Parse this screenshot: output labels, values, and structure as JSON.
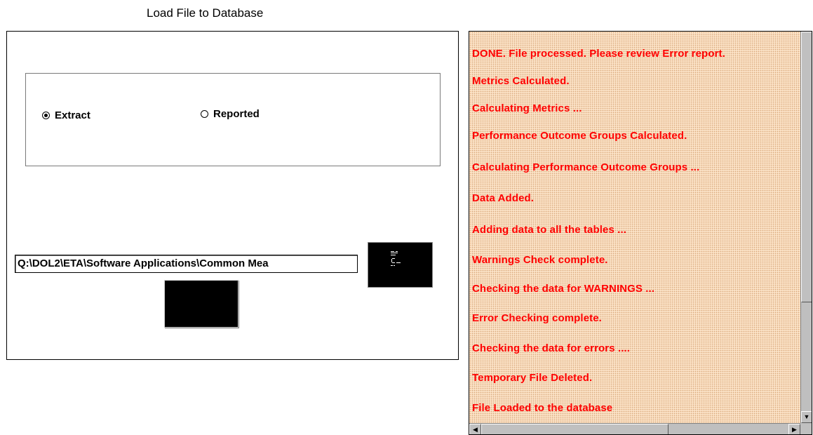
{
  "window": {
    "title": "Load File to Database"
  },
  "file_type": {
    "options": [
      {
        "label": "Extract",
        "selected": true
      },
      {
        "label": "Reported",
        "selected": false
      }
    ]
  },
  "file_path": {
    "value": "Q:\\DOL2\\ETA\\Software Applications\\Common Mea"
  },
  "log": {
    "text_color": "#ff0000",
    "background_color": "#fbe2c6",
    "items": [
      "DONE. File processed. Please review Error report.",
      "Metrics Calculated.",
      "Calculating Metrics ...",
      "Performance Outcome Groups Calculated.",
      "Calculating Performance Outcome Groups ...",
      "Data Added.",
      "Adding data to all the tables ...",
      "Warnings Check complete.",
      "Checking the data for WARNINGS ...",
      "Error Checking complete.",
      "Checking the data for errors ....",
      "Temporary File Deleted.",
      "File Loaded to the database"
    ]
  },
  "icons": {
    "browse": "folder-browse-icon",
    "scroll_down": "arrow-down-icon",
    "scroll_left": "arrow-left-icon",
    "scroll_right": "arrow-right-icon"
  }
}
